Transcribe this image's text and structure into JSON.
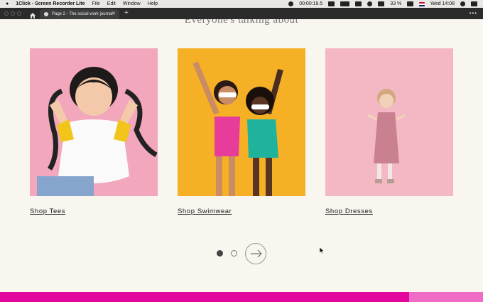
{
  "menubar": {
    "app_name": "1Click - Screen Recorder Lite",
    "menus": [
      "File",
      "Edit",
      "Window",
      "Help"
    ],
    "timer": "00:00:19.5",
    "battery": "33 %",
    "datetime": "Wed 14:08"
  },
  "browser": {
    "tab_title": "Page 2 - The social work journal",
    "tab_close": "✕",
    "new_tab": "+",
    "more": "•••"
  },
  "section": {
    "heading": "Everyone's talking about"
  },
  "products": [
    {
      "link": "Shop Tees",
      "image": "girl-lying-on-pink-background"
    },
    {
      "link": "Shop Swimwear",
      "image": "two-girls-in-swimsuits-yellow-background"
    },
    {
      "link": "Shop Dresses",
      "image": "girl-in-pink-dress-pink-background"
    }
  ],
  "carousel": {
    "current_page": 1,
    "total_pages": 2
  },
  "colors": {
    "accent_pink": "#e1069c",
    "accent_pink_light": "#ef6cc5",
    "page_bg": "#f9f5ef"
  }
}
